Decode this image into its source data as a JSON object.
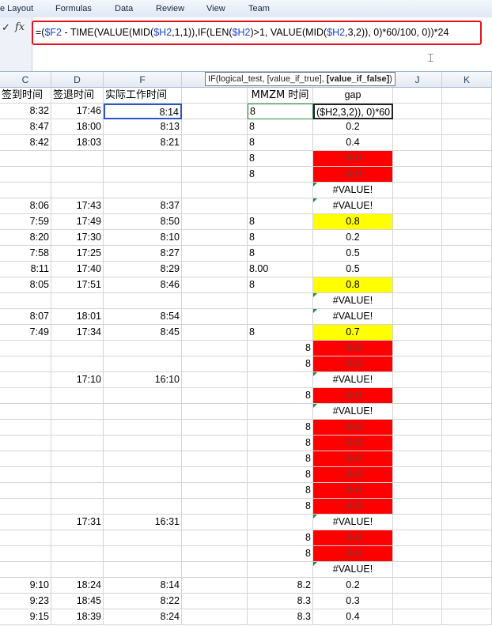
{
  "menu": [
    "e Layout",
    "Formulas",
    "Data",
    "Review",
    "View",
    "Team"
  ],
  "formula_bar": {
    "check_icon": "✓",
    "fx_label": "fx",
    "formula_parts": [
      "=(",
      "$F2",
      " - TIME(VALUE(MID(",
      "$H2",
      ",1,1)),IF(LEN(",
      "$H2",
      ")>1, VALUE(MID(",
      "$H2",
      ",3,2)), 0)*60/100, 0))*24"
    ]
  },
  "tooltip": {
    "main": "IF(logical_test, [value_if_true], ",
    "bold": "[value_if_false]",
    "end": ")"
  },
  "columns": {
    "C": "C",
    "D": "D",
    "F": "F",
    "J": "J",
    "K": "K"
  },
  "headers": {
    "c": "签到时间",
    "d": "签退时间",
    "f": "实际工作时间",
    "h": "MMZM 时间",
    "i": "gap"
  },
  "rows": [
    {
      "c": "8:32",
      "d": "17:46",
      "f": "8:14",
      "h": "8",
      "i": "($H2,3,2)), 0)*60",
      "hal": "left",
      "ist": "active"
    },
    {
      "c": "8:47",
      "d": "18:00",
      "f": "8:13",
      "h": "8",
      "i": "0.2",
      "hal": "left",
      "ist": ""
    },
    {
      "c": "8:42",
      "d": "18:03",
      "f": "8:21",
      "h": "8",
      "i": "0.4",
      "hal": "left",
      "ist": ""
    },
    {
      "c": "",
      "d": "",
      "f": "",
      "h": "8",
      "i": "-8.0",
      "hal": "left",
      "ist": "red"
    },
    {
      "c": "",
      "d": "",
      "f": "",
      "h": "8",
      "i": "-8.0",
      "hal": "left",
      "ist": "red"
    },
    {
      "c": "",
      "d": "",
      "f": "",
      "h": "",
      "i": "#VALUE!",
      "hal": "left",
      "ist": "tri"
    },
    {
      "c": "8:06",
      "d": "17:43",
      "f": "8:37",
      "h": "",
      "i": "#VALUE!",
      "hal": "left",
      "ist": "tri"
    },
    {
      "c": "7:59",
      "d": "17:49",
      "f": "8:50",
      "h": "8",
      "i": "0.8",
      "hal": "left",
      "ist": "yellow"
    },
    {
      "c": "8:20",
      "d": "17:30",
      "f": "8:10",
      "h": "8",
      "i": "0.2",
      "hal": "left",
      "ist": ""
    },
    {
      "c": "7:58",
      "d": "17:25",
      "f": "8:27",
      "h": "8",
      "i": "0.5",
      "hal": "left",
      "ist": ""
    },
    {
      "c": "8:11",
      "d": "17:40",
      "f": "8:29",
      "h": "8.00",
      "i": "0.5",
      "hal": "left",
      "ist": ""
    },
    {
      "c": "8:05",
      "d": "17:51",
      "f": "8:46",
      "h": "8",
      "i": "0.8",
      "hal": "left",
      "ist": "yellow"
    },
    {
      "c": "",
      "d": "",
      "f": "",
      "h": "",
      "i": "#VALUE!",
      "hal": "left",
      "ist": "tri"
    },
    {
      "c": "8:07",
      "d": "18:01",
      "f": "8:54",
      "h": "",
      "i": "#VALUE!",
      "hal": "left",
      "ist": "tri"
    },
    {
      "c": "7:49",
      "d": "17:34",
      "f": "8:45",
      "h": "8",
      "i": "0.7",
      "hal": "left",
      "ist": "yellow"
    },
    {
      "c": "",
      "d": "",
      "f": "",
      "h": "8",
      "i": "-8.0",
      "hal": "right",
      "ist": "red"
    },
    {
      "c": "",
      "d": "",
      "f": "",
      "h": "8",
      "i": "-8.0",
      "hal": "right",
      "ist": "red"
    },
    {
      "c": "",
      "d": "17:10",
      "f": "16:10",
      "h": "",
      "i": "#VALUE!",
      "hal": "right",
      "ist": "tri"
    },
    {
      "c": "",
      "d": "",
      "f": "",
      "h": "8",
      "i": "-8.0",
      "hal": "right",
      "ist": "red"
    },
    {
      "c": "",
      "d": "",
      "f": "",
      "h": "",
      "i": "#VALUE!",
      "hal": "right",
      "ist": "tri"
    },
    {
      "c": "",
      "d": "",
      "f": "",
      "h": "8",
      "i": "-8.0",
      "hal": "right",
      "ist": "red"
    },
    {
      "c": "",
      "d": "",
      "f": "",
      "h": "8",
      "i": "-8.0",
      "hal": "right",
      "ist": "red"
    },
    {
      "c": "",
      "d": "",
      "f": "",
      "h": "8",
      "i": "-8.0",
      "hal": "right",
      "ist": "red"
    },
    {
      "c": "",
      "d": "",
      "f": "",
      "h": "8",
      "i": "-8.0",
      "hal": "right",
      "ist": "red"
    },
    {
      "c": "",
      "d": "",
      "f": "",
      "h": "8",
      "i": "-8.0",
      "hal": "right",
      "ist": "red"
    },
    {
      "c": "",
      "d": "",
      "f": "",
      "h": "8",
      "i": "-8.0",
      "hal": "right",
      "ist": "red"
    },
    {
      "c": "",
      "d": "17:31",
      "f": "16:31",
      "h": "",
      "i": "#VALUE!",
      "hal": "right",
      "ist": "tri"
    },
    {
      "c": "",
      "d": "",
      "f": "",
      "h": "8",
      "i": "-8.0",
      "hal": "right",
      "ist": "red"
    },
    {
      "c": "",
      "d": "",
      "f": "",
      "h": "8",
      "i": "-8.0",
      "hal": "right",
      "ist": "red"
    },
    {
      "c": "",
      "d": "",
      "f": "",
      "h": "",
      "i": "#VALUE!",
      "hal": "right",
      "ist": "tri"
    },
    {
      "c": "9:10",
      "d": "18:24",
      "f": "8:14",
      "h": "8.2",
      "i": "0.2",
      "hal": "right",
      "ist": ""
    },
    {
      "c": "9:23",
      "d": "18:45",
      "f": "8:22",
      "h": "8.3",
      "i": "0.3",
      "hal": "right",
      "ist": ""
    },
    {
      "c": "9:15",
      "d": "18:39",
      "f": "8:24",
      "h": "8.3",
      "i": "0.4",
      "hal": "right",
      "ist": ""
    }
  ]
}
